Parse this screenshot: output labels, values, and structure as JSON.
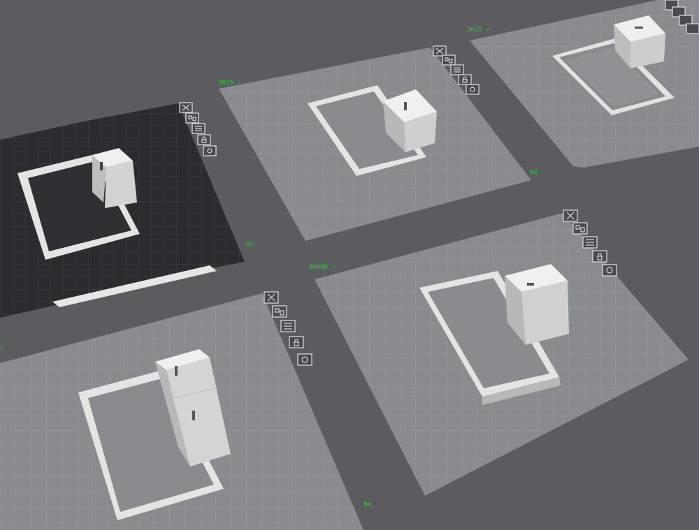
{
  "scene": {
    "background": "#5b5b60",
    "plate_color": "#888a8e",
    "plate_active_color": "#2b2b30",
    "grid_color": "#9a9ca0",
    "model_color": "#dcdcdc",
    "label_color": "#2ecc40"
  },
  "plates": [
    {
      "id": "plate-1",
      "active": true,
      "label": "01",
      "name_label": ""
    },
    {
      "id": "plate-2",
      "active": false,
      "label": "02",
      "name_label": "2025 ✓"
    },
    {
      "id": "plate-3",
      "active": false,
      "label": "",
      "name_label": "2025 ✓"
    },
    {
      "id": "plate-4",
      "active": false,
      "label": "04",
      "name_label": ""
    },
    {
      "id": "plate-5",
      "active": false,
      "label": "",
      "name_label": "BOARD ✓"
    }
  ],
  "toolbar_icons": [
    "close-icon",
    "arrange-icon",
    "orient-icon",
    "lock-icon",
    "settings-icon"
  ],
  "status_bar": {
    "left_text": "",
    "right_text": ""
  }
}
